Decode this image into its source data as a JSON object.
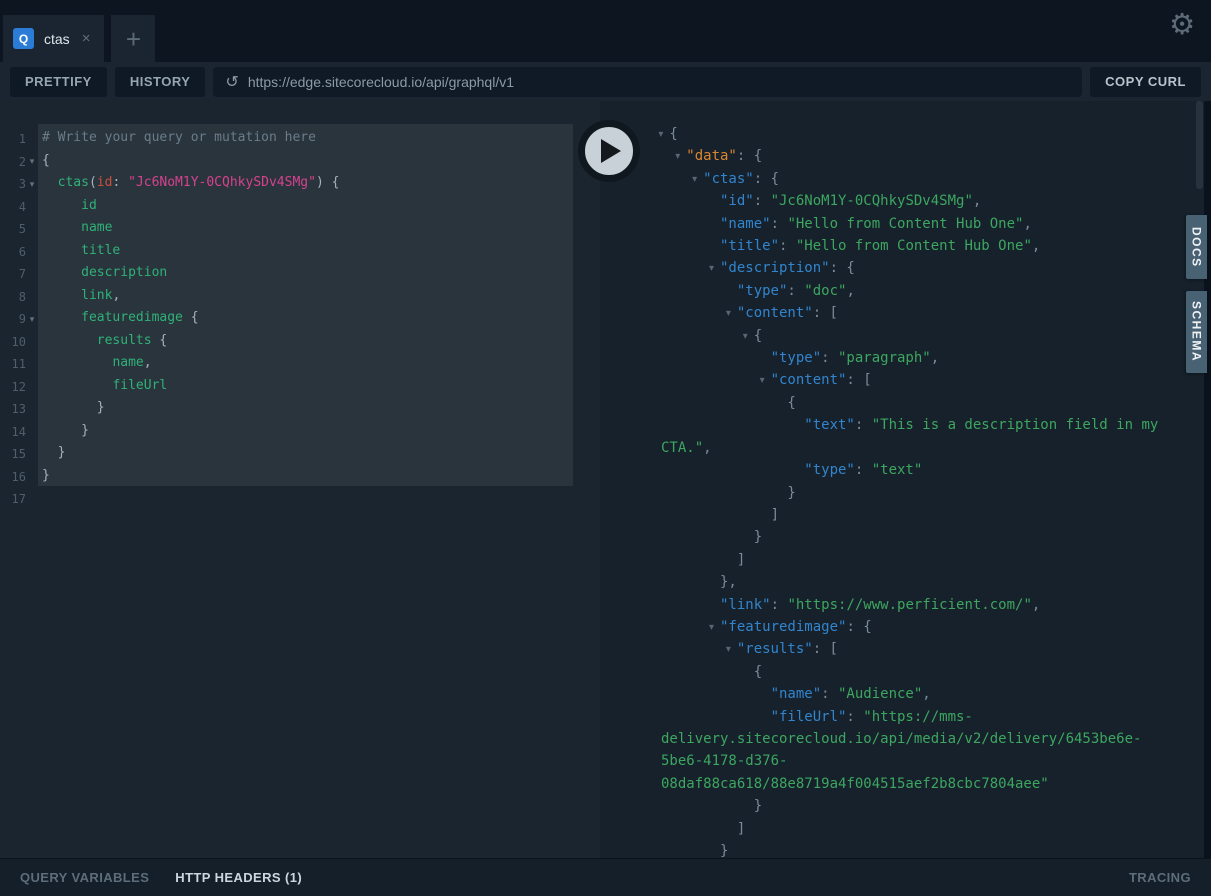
{
  "header": {
    "tab": {
      "badge": "Q",
      "label": "ctas"
    },
    "colors": {
      "badge_blue": "#2b7cd6"
    }
  },
  "icons": {
    "gear": "⚙",
    "replay": "↺",
    "close": "×",
    "plus": "+",
    "fold": "▾",
    "play": "play-triangle"
  },
  "toolbar": {
    "prettify": "PRETTIFY",
    "history": "HISTORY",
    "url": "https://edge.sitecorecloud.io/api/graphql/v1",
    "copy_curl": "COPY CURL"
  },
  "side_tabs": {
    "docs": "DOCS",
    "schema": "SCHEMA"
  },
  "footer": {
    "query_variables": "QUERY VARIABLES",
    "http_headers": "HTTP HEADERS (1)",
    "tracing": "TRACING"
  },
  "colors": {
    "editor_field_green": "#2fb277",
    "editor_string_pink": "#d6428e",
    "editor_attr_red": "#c8503c",
    "result_key_blue": "#3285cd",
    "result_data_orange": "#da862e",
    "result_string_green": "#3da65f",
    "side_tab_slate": "#486274"
  },
  "editor": {
    "gutter_count": 17,
    "fold_lines": [
      2,
      3,
      9
    ],
    "lines": [
      {
        "ind": 0,
        "t": [
          [
            "com",
            "# Write your query or mutation here"
          ]
        ]
      },
      {
        "ind": 0,
        "t": [
          [
            "p",
            "{"
          ]
        ]
      },
      {
        "ind": 2,
        "t": [
          [
            "fld",
            "ctas"
          ],
          [
            "p",
            "("
          ],
          [
            "attr",
            "id"
          ],
          [
            "p",
            ": "
          ],
          [
            "str",
            "\"Jc6NoM1Y-0CQhkySDv4SMg\""
          ],
          [
            "p",
            ") {"
          ]
        ]
      },
      {
        "ind": 5,
        "t": [
          [
            "fld",
            "id"
          ]
        ]
      },
      {
        "ind": 5,
        "t": [
          [
            "fld",
            "name"
          ]
        ]
      },
      {
        "ind": 5,
        "t": [
          [
            "fld",
            "title"
          ]
        ]
      },
      {
        "ind": 5,
        "t": [
          [
            "fld",
            "description"
          ]
        ]
      },
      {
        "ind": 5,
        "t": [
          [
            "fld",
            "link"
          ],
          [
            "p",
            ","
          ]
        ]
      },
      {
        "ind": 5,
        "t": [
          [
            "fld",
            "featuredimage"
          ],
          [
            "p",
            " {"
          ]
        ]
      },
      {
        "ind": 7,
        "t": [
          [
            "fld",
            "results"
          ],
          [
            "p",
            " {"
          ]
        ]
      },
      {
        "ind": 9,
        "t": [
          [
            "fld",
            "name"
          ],
          [
            "p",
            ","
          ]
        ]
      },
      {
        "ind": 9,
        "t": [
          [
            "fld",
            "fileUrl"
          ]
        ]
      },
      {
        "ind": 7,
        "t": [
          [
            "p",
            "}"
          ]
        ]
      },
      {
        "ind": 5,
        "t": [
          [
            "p",
            "}"
          ]
        ]
      },
      {
        "ind": 2,
        "t": [
          [
            "p",
            "}"
          ]
        ]
      },
      {
        "ind": 0,
        "t": [
          [
            "p",
            "}"
          ]
        ]
      }
    ]
  },
  "results": {
    "lines": [
      {
        "ind": 1,
        "f": true,
        "t": [
          [
            "rp",
            "{"
          ]
        ]
      },
      {
        "ind": 3,
        "f": true,
        "t": [
          [
            "okey",
            "\"data\""
          ],
          [
            "rp",
            ": {"
          ]
        ]
      },
      {
        "ind": 5,
        "f": true,
        "t": [
          [
            "key",
            "\"ctas\""
          ],
          [
            "rp",
            ": {"
          ]
        ]
      },
      {
        "ind": 7,
        "f": false,
        "t": [
          [
            "key",
            "\"id\""
          ],
          [
            "rp",
            ": "
          ],
          [
            "rstr",
            "\"Jc6NoM1Y-0CQhkySDv4SMg\""
          ],
          [
            "rp",
            ","
          ]
        ]
      },
      {
        "ind": 7,
        "f": false,
        "t": [
          [
            "key",
            "\"name\""
          ],
          [
            "rp",
            ": "
          ],
          [
            "rstr",
            "\"Hello from Content Hub One\""
          ],
          [
            "rp",
            ","
          ]
        ]
      },
      {
        "ind": 7,
        "f": false,
        "t": [
          [
            "key",
            "\"title\""
          ],
          [
            "rp",
            ": "
          ],
          [
            "rstr",
            "\"Hello from Content Hub One\""
          ],
          [
            "rp",
            ","
          ]
        ]
      },
      {
        "ind": 7,
        "f": true,
        "t": [
          [
            "key",
            "\"description\""
          ],
          [
            "rp",
            ": {"
          ]
        ]
      },
      {
        "ind": 9,
        "f": false,
        "t": [
          [
            "key",
            "\"type\""
          ],
          [
            "rp",
            ": "
          ],
          [
            "rstr",
            "\"doc\""
          ],
          [
            "rp",
            ","
          ]
        ]
      },
      {
        "ind": 9,
        "f": true,
        "t": [
          [
            "key",
            "\"content\""
          ],
          [
            "rp",
            ": ["
          ]
        ]
      },
      {
        "ind": 11,
        "f": true,
        "t": [
          [
            "rp",
            "{"
          ]
        ]
      },
      {
        "ind": 13,
        "f": false,
        "t": [
          [
            "key",
            "\"type\""
          ],
          [
            "rp",
            ": "
          ],
          [
            "rstr",
            "\"paragraph\""
          ],
          [
            "rp",
            ","
          ]
        ]
      },
      {
        "ind": 13,
        "f": true,
        "t": [
          [
            "key",
            "\"content\""
          ],
          [
            "rp",
            ": ["
          ]
        ]
      },
      {
        "ind": 15,
        "f": false,
        "t": [
          [
            "rp",
            "{"
          ]
        ]
      },
      {
        "ind": 17,
        "f": false,
        "t": [
          [
            "key",
            "\"text\""
          ],
          [
            "rp",
            ": "
          ],
          [
            "rstr",
            "\"This is a description field in my"
          ]
        ]
      },
      {
        "ind": 0,
        "f": false,
        "t": [
          [
            "rstr",
            "CTA.\""
          ],
          [
            "rp",
            ","
          ]
        ]
      },
      {
        "ind": 17,
        "f": false,
        "t": [
          [
            "key",
            "\"type\""
          ],
          [
            "rp",
            ": "
          ],
          [
            "rstr",
            "\"text\""
          ]
        ]
      },
      {
        "ind": 15,
        "f": false,
        "t": [
          [
            "rp",
            "}"
          ]
        ]
      },
      {
        "ind": 13,
        "f": false,
        "t": [
          [
            "rp",
            "]"
          ]
        ]
      },
      {
        "ind": 11,
        "f": false,
        "t": [
          [
            "rp",
            "}"
          ]
        ]
      },
      {
        "ind": 9,
        "f": false,
        "t": [
          [
            "rp",
            "]"
          ]
        ]
      },
      {
        "ind": 7,
        "f": false,
        "t": [
          [
            "rp",
            "},"
          ]
        ]
      },
      {
        "ind": 7,
        "f": false,
        "t": [
          [
            "key",
            "\"link\""
          ],
          [
            "rp",
            ": "
          ],
          [
            "rstr",
            "\"https://www.perficient.com/\""
          ],
          [
            "rp",
            ","
          ]
        ]
      },
      {
        "ind": 7,
        "f": true,
        "t": [
          [
            "key",
            "\"featuredimage\""
          ],
          [
            "rp",
            ": {"
          ]
        ]
      },
      {
        "ind": 9,
        "f": true,
        "t": [
          [
            "key",
            "\"results\""
          ],
          [
            "rp",
            ": ["
          ]
        ]
      },
      {
        "ind": 11,
        "f": false,
        "t": [
          [
            "rp",
            "{"
          ]
        ]
      },
      {
        "ind": 13,
        "f": false,
        "t": [
          [
            "key",
            "\"name\""
          ],
          [
            "rp",
            ": "
          ],
          [
            "rstr",
            "\"Audience\""
          ],
          [
            "rp",
            ","
          ]
        ]
      },
      {
        "ind": 13,
        "f": false,
        "t": [
          [
            "key",
            "\"fileUrl\""
          ],
          [
            "rp",
            ": "
          ],
          [
            "rstr",
            "\"https://mms-"
          ]
        ]
      },
      {
        "ind": 0,
        "f": false,
        "t": [
          [
            "rstr",
            "delivery.sitecorecloud.io/api/media/v2/delivery/6453be6e-"
          ]
        ]
      },
      {
        "ind": 0,
        "f": false,
        "t": [
          [
            "rstr",
            "5be6-4178-d376-"
          ]
        ]
      },
      {
        "ind": 0,
        "f": false,
        "t": [
          [
            "rstr",
            "08daf88ca618/88e8719a4f004515aef2b8cbc7804aee\""
          ]
        ]
      },
      {
        "ind": 11,
        "f": false,
        "t": [
          [
            "rp",
            "}"
          ]
        ]
      },
      {
        "ind": 9,
        "f": false,
        "t": [
          [
            "rp",
            "]"
          ]
        ]
      },
      {
        "ind": 7,
        "f": false,
        "t": [
          [
            "rp",
            "}"
          ]
        ]
      }
    ]
  }
}
